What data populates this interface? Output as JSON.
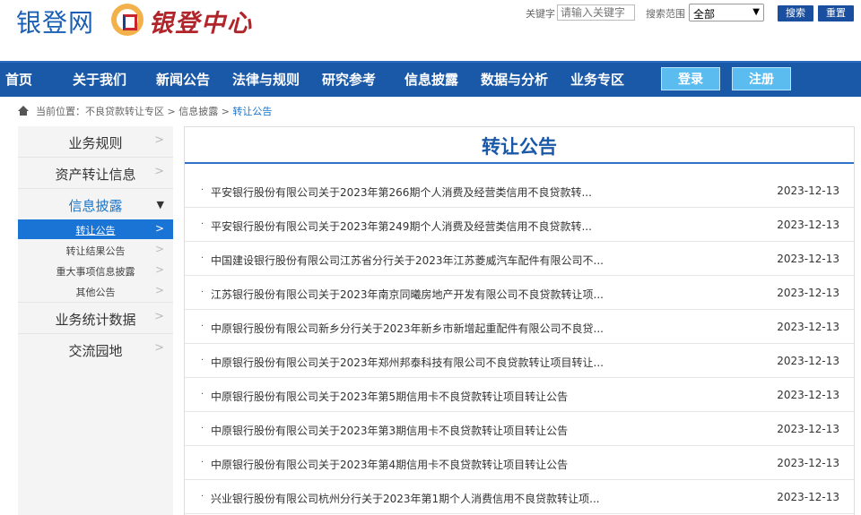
{
  "header": {
    "brand_name": "银登网",
    "brand_logo_text": "银登中心",
    "search": {
      "keyword_label": "关键字",
      "keyword_placeholder": "请输入关键字",
      "range_label": "搜索范围",
      "range_selected": "全部",
      "search_button": "搜索",
      "reset_button": "重置"
    }
  },
  "nav": {
    "items": [
      "首页",
      "关于我们",
      "新闻公告",
      "法律与规则",
      "研究参考",
      "信息披露",
      "数据与分析",
      "业务专区"
    ],
    "login": "登录",
    "register": "注册"
  },
  "breadcrumb": {
    "prefix": "当前位置：",
    "path": "不良贷款转让专区 > 信息披露 > ",
    "current": "转让公告"
  },
  "sidebar": {
    "items": [
      {
        "label": "业务规则"
      },
      {
        "label": "资产转让信息"
      },
      {
        "label": "信息披露"
      },
      {
        "label": "业务统计数据"
      },
      {
        "label": "交流园地"
      }
    ],
    "sub_items": [
      {
        "label": "转让公告"
      },
      {
        "label": "转让结果公告"
      },
      {
        "label": "重大事项信息披露"
      },
      {
        "label": "其他公告"
      }
    ]
  },
  "content": {
    "title": "转让公告",
    "rows": [
      {
        "text": "平安银行股份有限公司关于2023年第266期个人消费及经营类信用不良贷款转...",
        "date": "2023-12-13"
      },
      {
        "text": "平安银行股份有限公司关于2023年第249期个人消费及经营类信用不良贷款转...",
        "date": "2023-12-13"
      },
      {
        "text": "中国建设银行股份有限公司江苏省分行关于2023年江苏菱威汽车配件有限公司不...",
        "date": "2023-12-13"
      },
      {
        "text": "江苏银行股份有限公司关于2023年南京同曦房地产开发有限公司不良贷款转让项...",
        "date": "2023-12-13"
      },
      {
        "text": "中原银行股份有限公司新乡分行关于2023年新乡市新增起重配件有限公司不良贷...",
        "date": "2023-12-13"
      },
      {
        "text": "中原银行股份有限公司关于2023年郑州邦泰科技有限公司不良贷款转让项目转让...",
        "date": "2023-12-13"
      },
      {
        "text": "中原银行股份有限公司关于2023年第5期信用卡不良贷款转让项目转让公告",
        "date": "2023-12-13"
      },
      {
        "text": "中原银行股份有限公司关于2023年第3期信用卡不良贷款转让项目转让公告",
        "date": "2023-12-13"
      },
      {
        "text": "中原银行股份有限公司关于2023年第4期信用卡不良贷款转让项目转让公告",
        "date": "2023-12-13"
      },
      {
        "text": "兴业银行股份有限公司杭州分行关于2023年第1期个人消费信用不良贷款转让项...",
        "date": "2023-12-13"
      }
    ]
  }
}
